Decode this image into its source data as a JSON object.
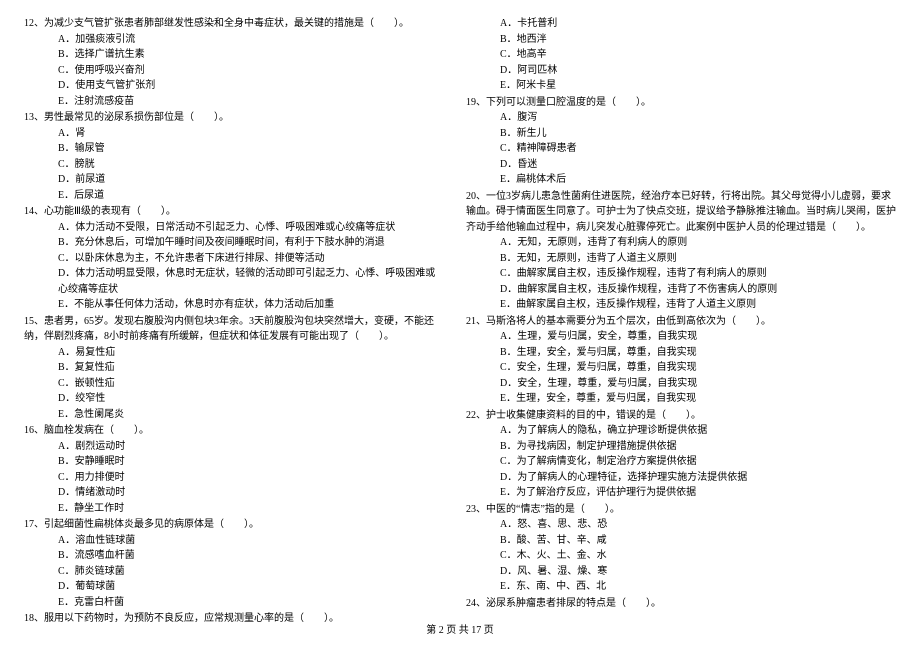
{
  "footer": "第 2 页 共 17 页",
  "left": [
    {
      "stem": "12、为减少支气管扩张患者肺部继发性感染和全身中毒症状，最关键的措施是（　　）。",
      "opts": [
        "A．加强痰液引流",
        "B．选择广谱抗生素",
        "C．使用呼吸兴奋剂",
        "D．使用支气管扩张剂",
        "E．注射流感疫苗"
      ]
    },
    {
      "stem": "13、男性最常见的泌尿系损伤部位是（　　）。",
      "opts": [
        "A．肾",
        "B．输尿管",
        "C．膀胱",
        "D．前尿道",
        "E．后尿道"
      ]
    },
    {
      "stem": "14、心功能Ⅲ级的表现有（　　）。",
      "opts": [
        "A．体力活动不受限，日常活动不引起乏力、心悸、呼吸困难或心绞痛等症状",
        "B．充分休息后，可增加午睡时间及夜间睡眠时间，有利于下肢水肿的消退",
        "C．以卧床休息为主，不允许患者下床进行排尿、排便等活动",
        "D．体力活动明显受限，休息时无症状，轻微的活动即可引起乏力、心悸、呼吸困难或心绞痛等症状",
        "E．不能从事任何体力活动，休息时亦有症状，体力活动后加重"
      ]
    },
    {
      "stem": "15、患者男，65岁。发现右腹股沟内侧包块3年余。3天前腹股沟包块突然增大，变硬，不能还纳，伴剧烈疼痛，8小时前疼痛有所缓解，但症状和体征发展有可能出现了（　　）。",
      "opts": [
        "A．易复性疝",
        "B．复复性疝",
        "C．嵌顿性疝",
        "D．绞窄性",
        "E．急性阑尾炎"
      ]
    },
    {
      "stem": "16、脑血栓发病在（　　）。",
      "opts": [
        "A．剧烈运动时",
        "B．安静睡眠时",
        "C．用力排便时",
        "D．情绪激动时",
        "E．静坐工作时"
      ]
    },
    {
      "stem": "17、引起细菌性扁桃体炎最多见的病原体是（　　）。",
      "opts": [
        "A．溶血性链球菌",
        "B．流感嗜血杆菌",
        "C．肺炎链球菌",
        "D．葡萄球菌",
        "E．克雷白杆菌"
      ]
    },
    {
      "stem": "18、服用以下药物时，为预防不良反应，应常规测量心率的是（　　）。",
      "opts": []
    }
  ],
  "right": [
    {
      "stem": "",
      "opts": [
        "A．卡托普利",
        "B．地西泮",
        "C．地高辛",
        "D．阿司匹林",
        "E．阿米卡星"
      ]
    },
    {
      "stem": "19、下列可以测量口腔温度的是（　　）。",
      "opts": [
        "A．腹泻",
        "B．新生儿",
        "C．精神障碍患者",
        "D．昏迷",
        "E．扁桃体术后"
      ]
    },
    {
      "stem": "20、一位3岁病儿患急性菌痢住进医院，经治疗本已好转，行将出院。其父母觉得小儿虚弱，要求输血。碍于情面医生同意了。可护士为了快点交班，提议给予静脉推注输血。当时病儿哭闹，医护齐动手给他输血过程中，病儿突发心脏骤停死亡。此案例中医护人员的伦理过错是（　　）。",
      "opts": [
        "A．无知，无原则，违背了有利病人的原则",
        "B．无知，无原则，违背了人道主义原则",
        "C．曲解家属自主权，违反操作规程，违背了有利病人的原则",
        "D．曲解家属自主权，违反操作规程，违背了不伤害病人的原则",
        "E．曲解家属自主权，违反操作规程，违背了人道主义原则"
      ]
    },
    {
      "stem": "21、马斯洛将人的基本需要分为五个层次，由低到高依次为（　　）。",
      "opts": [
        "A．生理，爱与归属，安全，尊重，自我实现",
        "B．生理，安全，爱与归属，尊重，自我实现",
        "C．安全，生理，爱与归属，尊重，自我实现",
        "D．安全，生理，尊重，爱与归属，自我实现",
        "E．生理，安全，尊重，爱与归属，自我实现"
      ]
    },
    {
      "stem": "22、护士收集健康资料的目的中，错误的是（　　）。",
      "opts": [
        "A．为了解病人的隐私，确立护理诊断提供依据",
        "B．为寻找病因，制定护理措施提供依据",
        "C．为了解病情变化，制定治疗方案提供依据",
        "D．为了解病人的心理特征，选择护理实施方法提供依据",
        "E．为了解治疗反应，评估护理行为提供依据"
      ]
    },
    {
      "stem": "23、中医的“情志”指的是（　　）。",
      "opts": [
        "A．怒、喜、思、悲、恐",
        "B．酸、苦、甘、辛、咸",
        "C．木、火、土、金、水",
        "D．风、暑、湿、燥、寒",
        "E．东、南、中、西、北"
      ]
    },
    {
      "stem": "24、泌尿系肿瘤患者排尿的特点是（　　）。",
      "opts": []
    }
  ]
}
